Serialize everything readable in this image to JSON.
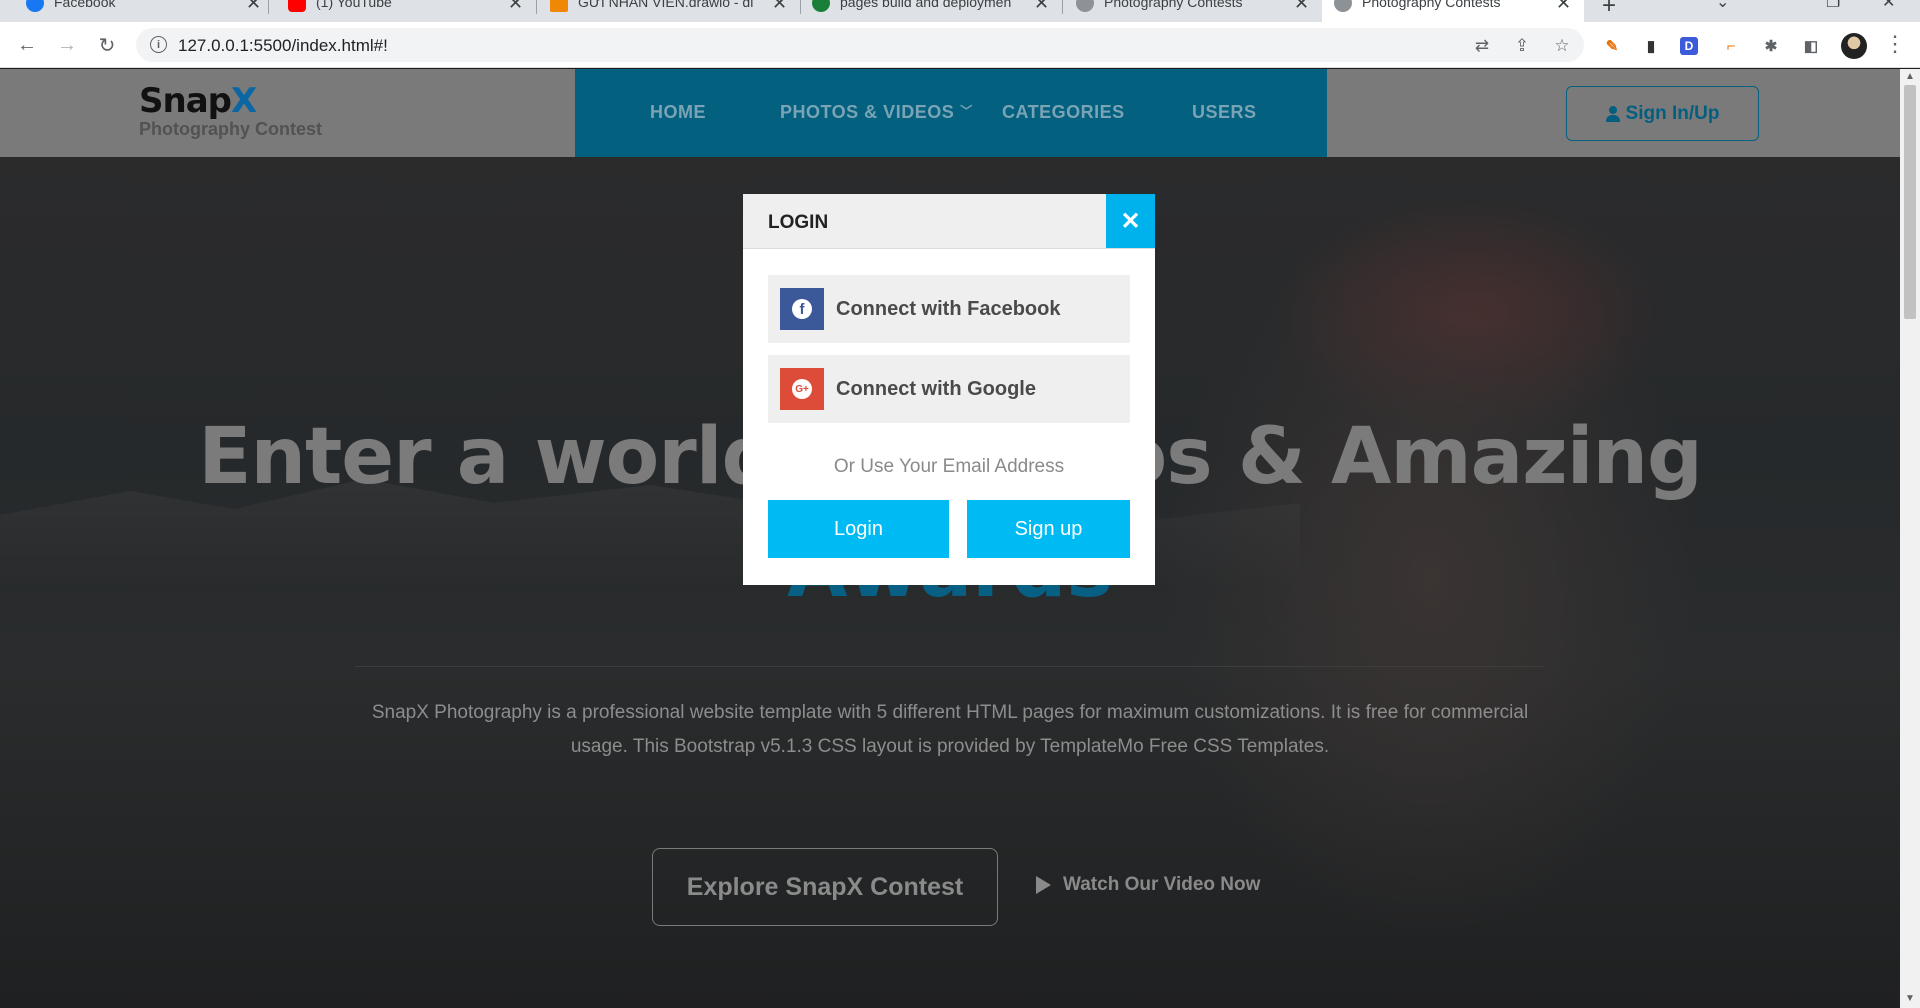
{
  "browser": {
    "tabs": [
      {
        "title": "Facebook",
        "favicon": "facebook-icon",
        "favicon_color": "#1877f2"
      },
      {
        "title": "(1) YouTube",
        "favicon": "youtube-icon",
        "favicon_color": "#ff0000"
      },
      {
        "title": "GỬI NHÂN VIÊN.drawio - di",
        "favicon": "drawio-icon",
        "favicon_color": "#f08705"
      },
      {
        "title": "pages build and deploymen",
        "favicon": "check-icon",
        "favicon_color": "#1a7f37"
      },
      {
        "title": "Photography Contests",
        "favicon": "globe-icon",
        "favicon_color": "#5f6368"
      },
      {
        "title": "Photography Contests",
        "favicon": "globe-icon",
        "favicon_color": "#5f6368",
        "active": true
      }
    ],
    "url": "127.0.0.1:5500/index.html#!"
  },
  "site": {
    "logo": {
      "brand_part1": "Snap",
      "brand_part2": "X",
      "subtitle": "Photography Contest"
    },
    "nav": {
      "home": "HOME",
      "photos_videos": "PHOTOS & VIDEOS",
      "categories": "CATEGORIES",
      "users": "USERS"
    },
    "signin_label": "Sign In/Up",
    "hero": {
      "title_line1": "Enter a world of Photos & Amazing",
      "title_line2": "Awards",
      "description": "SnapX Photography is a professional website template with 5 different HTML pages for maximum customizations. It is free for commercial usage. This Bootstrap v5.1.3 CSS layout is provided by TemplateMo Free CSS Templates.",
      "explore_label": "Explore SnapX Contest",
      "watch_label": "Watch Our Video Now"
    }
  },
  "modal": {
    "title": "LOGIN",
    "close_symbol": "✕",
    "facebook_label": "Connect with Facebook",
    "google_label": "Connect with Google",
    "or_text": "Or Use Your Email Address",
    "login_label": "Login",
    "signup_label": "Sign up"
  },
  "colors": {
    "accent": "#00bbf3",
    "facebook": "#3b5998",
    "google": "#dd4b39",
    "nav_bg": "#04607f"
  }
}
